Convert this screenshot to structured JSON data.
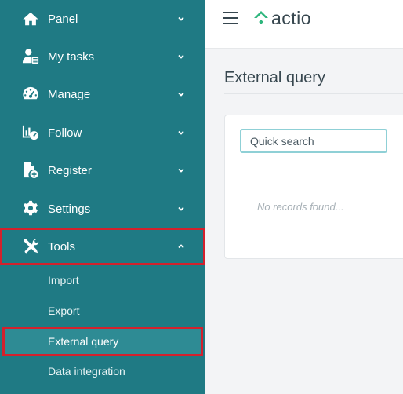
{
  "app": {
    "logo_text": "actio"
  },
  "colors": {
    "sidebar": "#1f7a84",
    "highlight": "#d3212d",
    "brand_green": "#2eb67d"
  },
  "sidebar": {
    "items": [
      {
        "label": "Panel",
        "icon": "home-icon",
        "expanded": false
      },
      {
        "label": "My tasks",
        "icon": "user-list-icon",
        "expanded": false
      },
      {
        "label": "Manage",
        "icon": "dashboard-gauge-icon",
        "expanded": false
      },
      {
        "label": "Follow",
        "icon": "chart-gauge-icon",
        "expanded": false
      },
      {
        "label": "Register",
        "icon": "file-plus-icon",
        "expanded": false
      },
      {
        "label": "Settings",
        "icon": "gear-icon",
        "expanded": false
      },
      {
        "label": "Tools",
        "icon": "tools-icon",
        "expanded": true
      }
    ],
    "tools_subitems": [
      {
        "label": "Import"
      },
      {
        "label": "Export"
      },
      {
        "label": "External query",
        "active": true
      },
      {
        "label": "Data integration"
      }
    ]
  },
  "main": {
    "page_title": "External query",
    "search": {
      "placeholder": "Quick search",
      "value": ""
    },
    "empty_message": "No records found..."
  }
}
